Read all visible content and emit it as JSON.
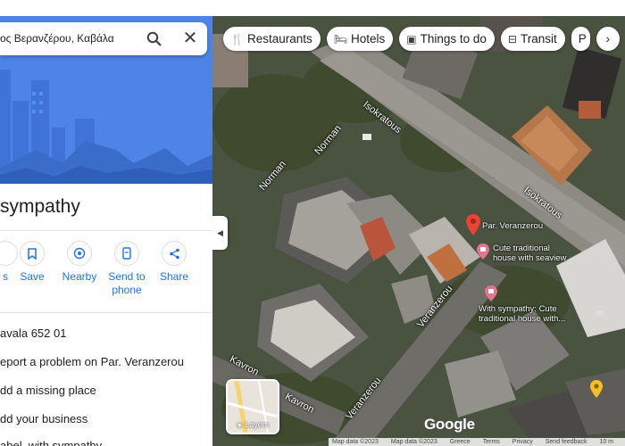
{
  "search": {
    "value": "ος Βερανζέρου, Καβάλα"
  },
  "place": {
    "title": "sympathy"
  },
  "actions": [
    {
      "label": "s"
    },
    {
      "label": "Save"
    },
    {
      "label": "Nearby"
    },
    {
      "label": "Send to\nphone"
    },
    {
      "label": "Share"
    }
  ],
  "info": {
    "address": "avala 652 01",
    "report": "eport a problem on Par. Veranzerou",
    "missing": "dd a missing place",
    "business": "dd your business",
    "label": "abel, with sympathy"
  },
  "chips": [
    {
      "label": "Restaurants",
      "icon": "restaurant-icon"
    },
    {
      "label": "Hotels",
      "icon": "hotel-icon"
    },
    {
      "label": "Things to do",
      "icon": "things-to-do-icon"
    },
    {
      "label": "Transit",
      "icon": "transit-icon"
    },
    {
      "label": "P",
      "icon": "parking-icon"
    }
  ],
  "map": {
    "streets": [
      "Norman",
      "Norman",
      "Isokratous",
      "Isokratous",
      "Veranzerou",
      "Veranzerou",
      "Kavron",
      "Kavron"
    ],
    "pois": [
      "Par. Veranzerou",
      "Cute traditional\nhouse with seaview",
      "With sympathy: Cute\ntraditional house with..."
    ],
    "layers_label": "Layers",
    "logo": "Google",
    "footer": [
      "Map data ©2023",
      "Map data ©2023",
      "Greece",
      "Terms",
      "Privacy",
      "Send feedback",
      "10 m"
    ]
  },
  "colors": {
    "accent": "#1a73e8",
    "hero": "#4d84e6",
    "pin_red": "#ea4335",
    "poi_pink": "#e8728f"
  }
}
